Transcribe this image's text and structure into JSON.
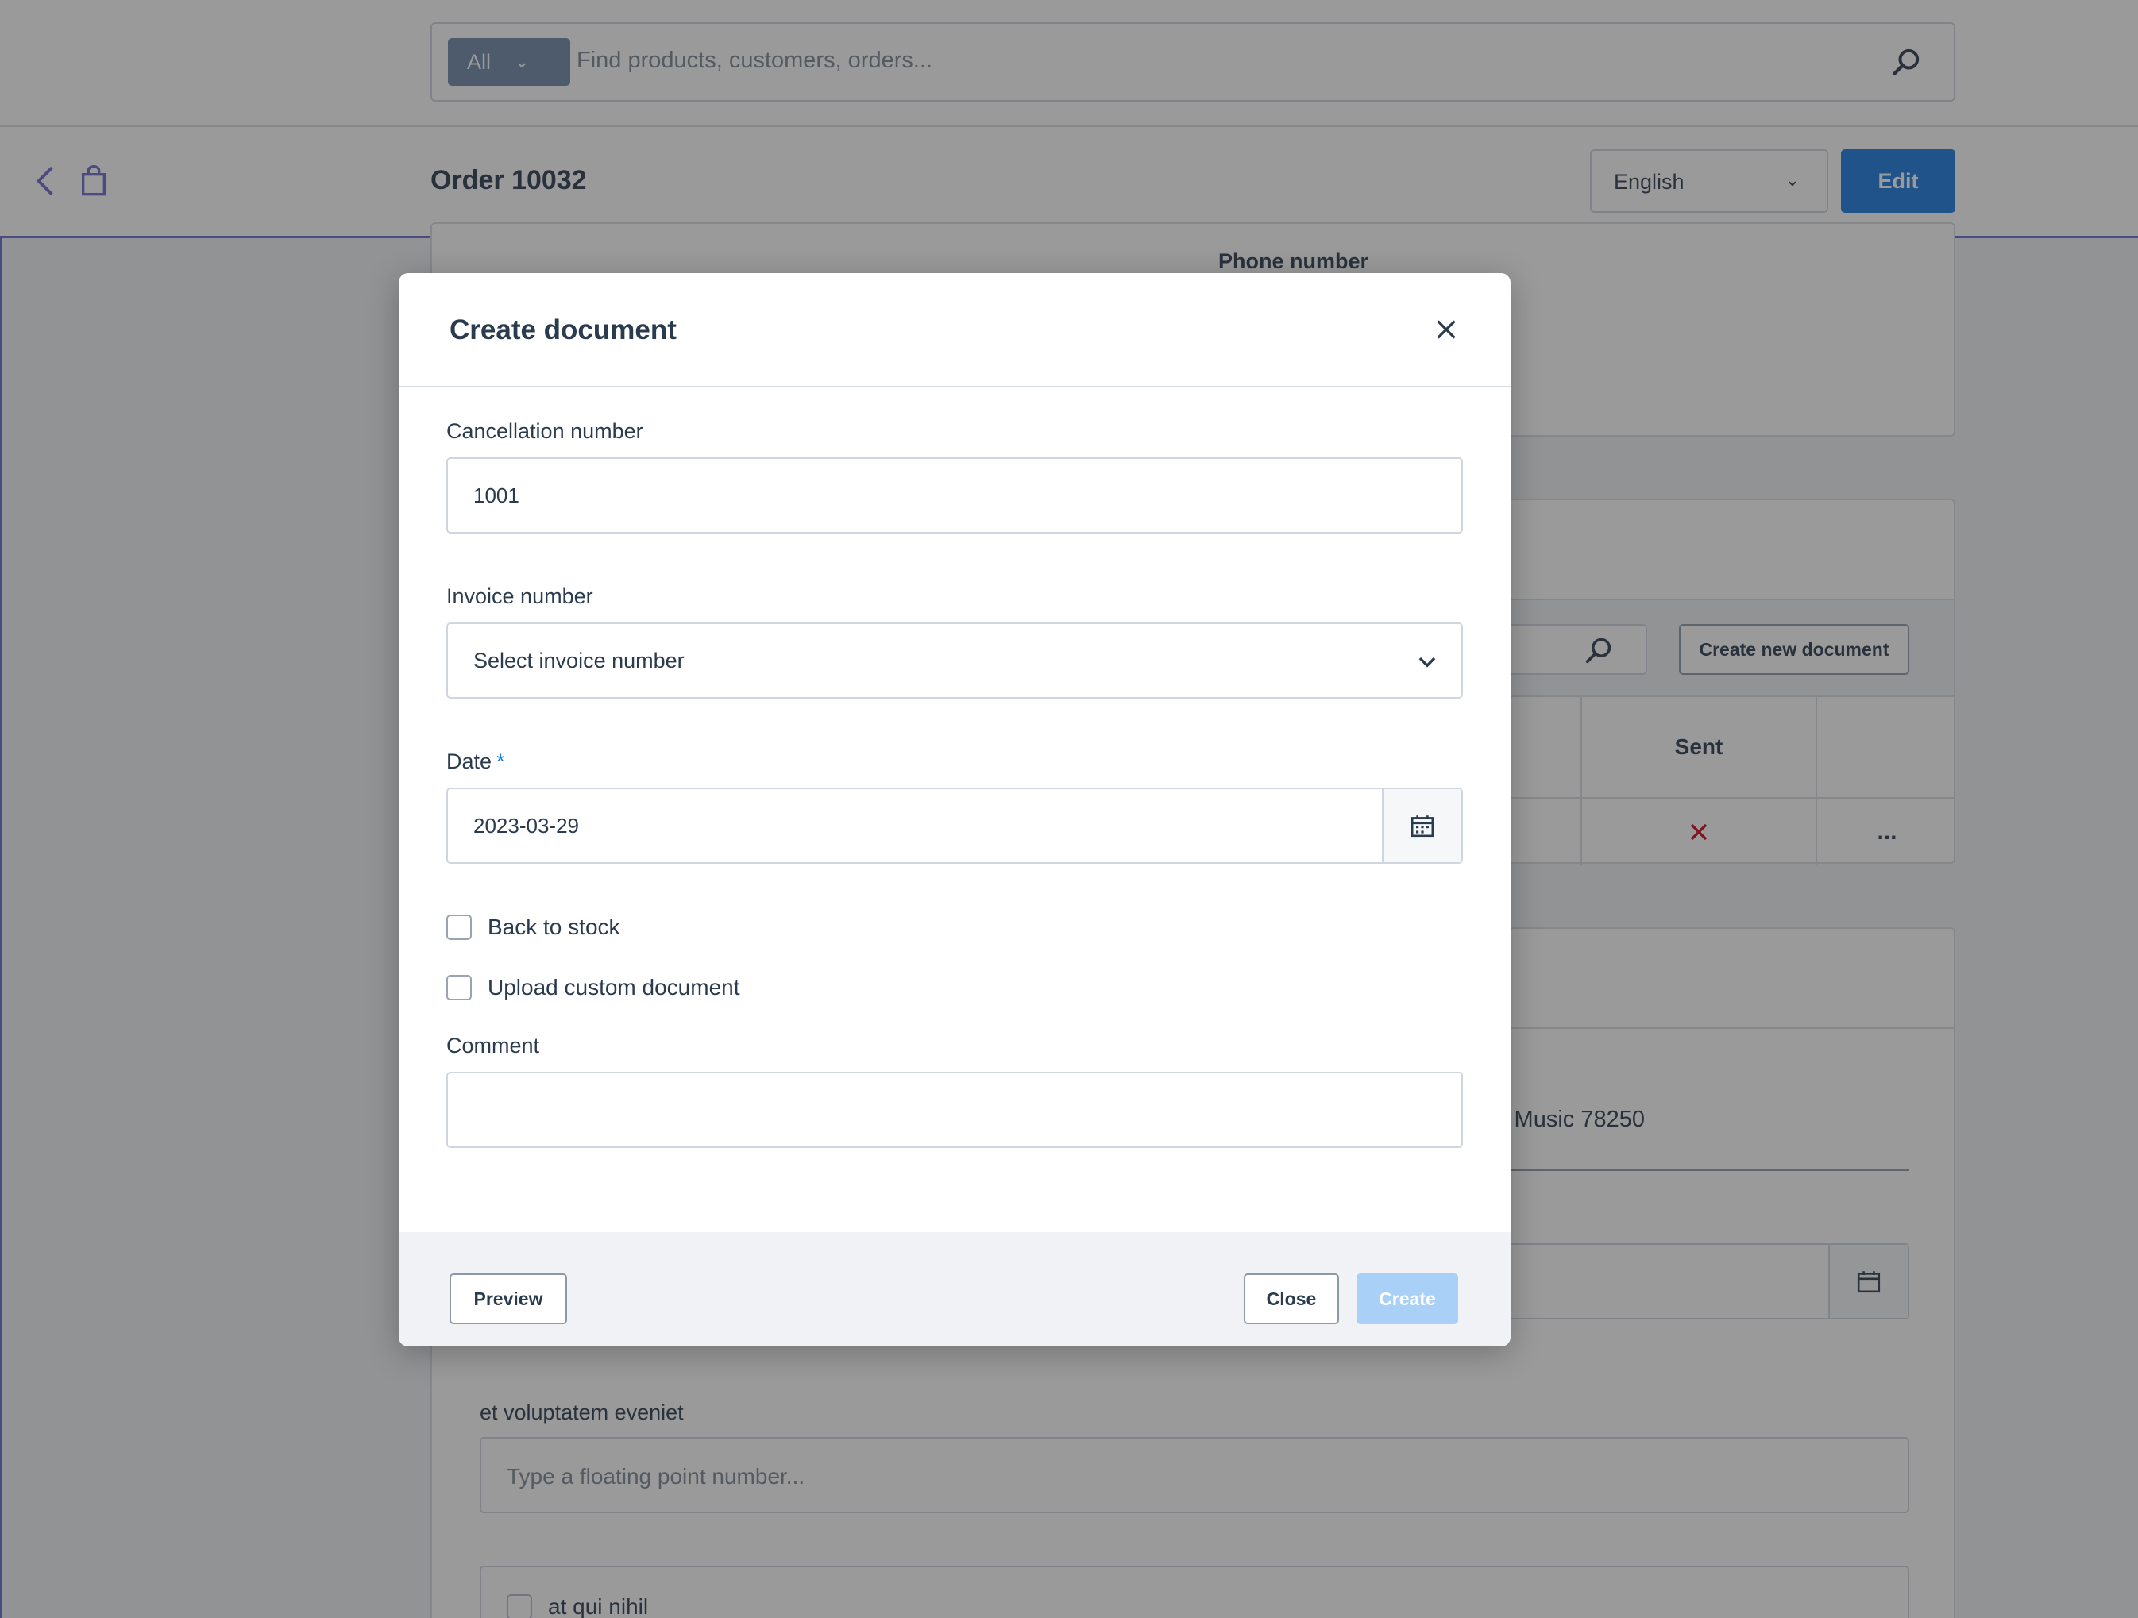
{
  "search": {
    "scope_label": "All",
    "placeholder": "Find products, customers, orders..."
  },
  "header": {
    "title": "Order 10032",
    "language": "English",
    "edit_label": "Edit"
  },
  "background": {
    "phone_label": "Phone number",
    "create_new_document_label": "Create new document",
    "sent_column": "Sent",
    "more_label": "...",
    "address_fragment": "c Music 78250",
    "float_field_label": "et voluptatem eveniet",
    "float_field_placeholder": "Type a floating point number...",
    "checkbox_label": "at qui nihil"
  },
  "modal": {
    "title": "Create document",
    "cancellation_label": "Cancellation number",
    "cancellation_value": "1001",
    "invoice_label": "Invoice number",
    "invoice_placeholder": "Select invoice number",
    "date_label": "Date",
    "date_required_mark": "*",
    "date_value": "2023-03-29",
    "back_to_stock_label": "Back to stock",
    "upload_custom_label": "Upload custom document",
    "comment_label": "Comment",
    "comment_value": "",
    "preview_label": "Preview",
    "close_label": "Close",
    "create_label": "Create"
  },
  "colors": {
    "primary": "#1a79e0",
    "create_disabled": "#a9d1f7",
    "header_accent": "#6b6bd1",
    "error_x": "#d0021b"
  }
}
